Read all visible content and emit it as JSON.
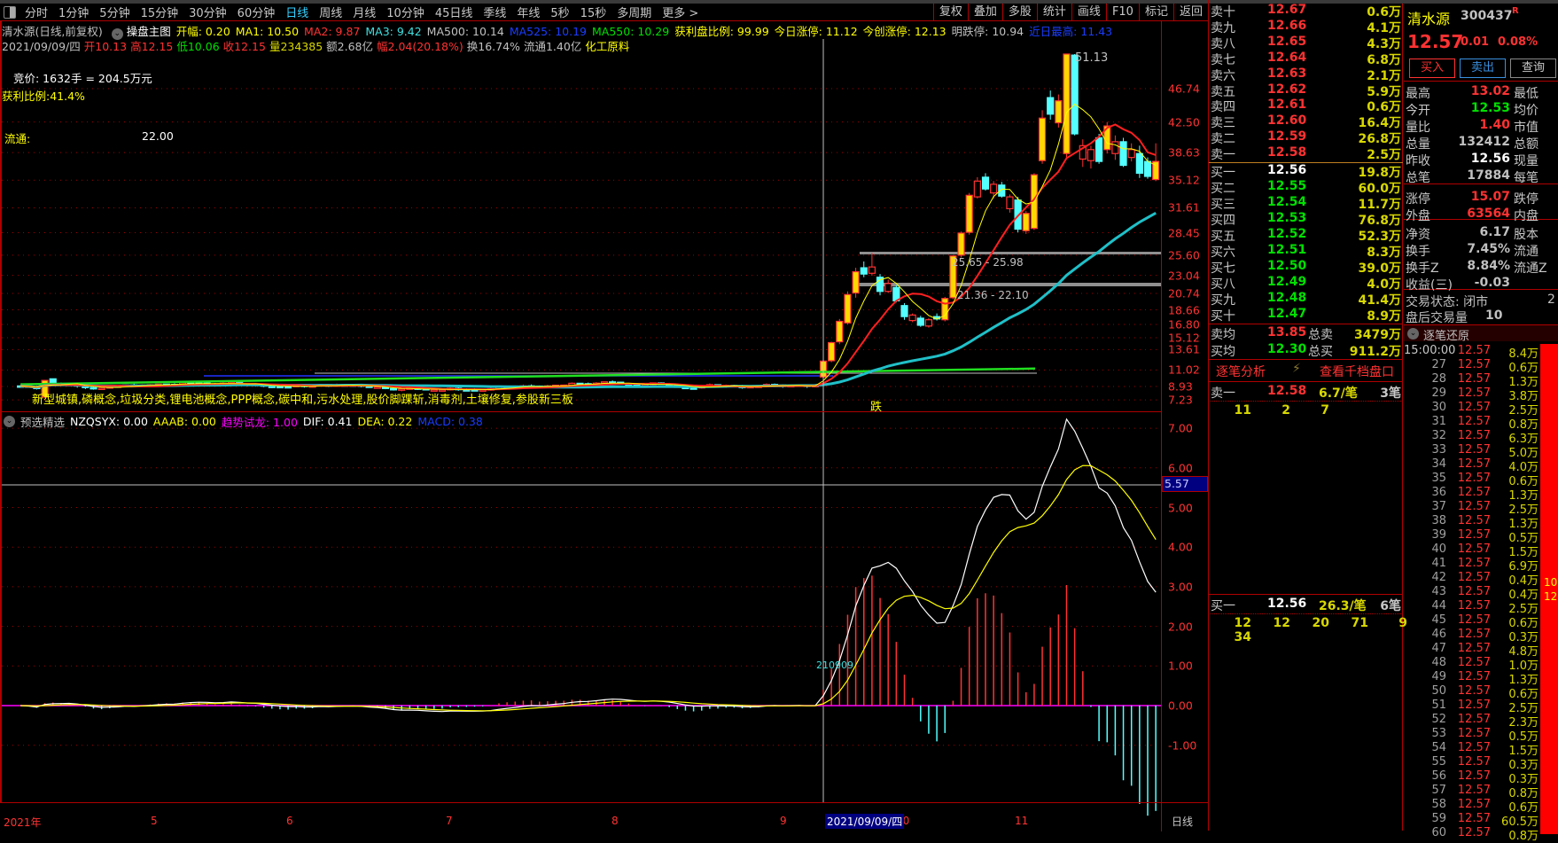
{
  "toolbar": {
    "periods": [
      "分时",
      "1分钟",
      "5分钟",
      "15分钟",
      "30分钟",
      "60分钟",
      "日线",
      "周线",
      "月线",
      "10分钟",
      "45日线",
      "季线",
      "年线",
      "5秒",
      "15秒",
      "多周期",
      "更多 >"
    ],
    "active_period": "日线",
    "right_buttons": [
      "复权",
      "叠加",
      "多股",
      "统计",
      "画线",
      "F10",
      "标记",
      "返回"
    ]
  },
  "info_line": [
    {
      "t": "清水源(日线,前复权)",
      "c": "gr"
    },
    {
      "t": "操盘主图",
      "c": "w"
    },
    {
      "t": "开幅: 0.20",
      "c": "y"
    },
    {
      "t": "MA1: 10.50",
      "c": "y"
    },
    {
      "t": "MA2: 9.87",
      "c": "r"
    },
    {
      "t": "MA3: 9.42",
      "c": "c"
    },
    {
      "t": "MA500: 10.14",
      "c": "gr"
    },
    {
      "t": "MA525: 10.19",
      "c": "b"
    },
    {
      "t": "MA550: 10.29",
      "c": "g"
    },
    {
      "t": "获利盘比例: 99.99",
      "c": "y"
    },
    {
      "t": "今日涨停: 11.12",
      "c": "y"
    },
    {
      "t": "今创涨停: 12.13",
      "c": "y"
    },
    {
      "t": "明跌停: 10.94",
      "c": "gr"
    },
    {
      "t": "近日最高: 11.43",
      "c": "b"
    }
  ],
  "bar_info": [
    {
      "t": "2021/09/09/四",
      "c": "gr"
    },
    {
      "t": "开10.13",
      "c": "r"
    },
    {
      "t": "高12.15",
      "c": "r"
    },
    {
      "t": "低10.06",
      "c": "g"
    },
    {
      "t": "收12.15",
      "c": "r"
    },
    {
      "t": "量234385",
      "c": "dy"
    },
    {
      "t": "额2.68亿",
      "c": "gr"
    },
    {
      "t": "幅2.04(20.18%)",
      "c": "r"
    },
    {
      "t": "换16.74%",
      "c": "gr"
    },
    {
      "t": "流通1.40亿",
      "c": "gr"
    },
    {
      "t": "化工原料",
      "c": "y"
    }
  ],
  "overlay": {
    "auction": "竞价: 1632手 = 204.5万元",
    "profit_ratio": "获利比例:41.4%",
    "float_label": "流通:",
    "float_value": "22.00",
    "concepts": "新型城镇,磷概念,垃圾分类,锂电池概念,PPP概念,碳中和,污水处理,股价脚踝斩,消毒剂,土壤修复,参股新三板",
    "high_label": "51.13",
    "zone1": "25.65 - 25.98",
    "zone2": "21.36 - 22.10",
    "signal_down": "跌",
    "macd_marker": "210909"
  },
  "price_axis": [
    "46.74",
    "42.50",
    "38.63",
    "35.12",
    "31.61",
    "28.45",
    "25.60",
    "23.04",
    "20.74",
    "18.66",
    "16.80",
    "15.12",
    "13.61",
    "11.02",
    "8.93",
    "7.23"
  ],
  "macd_axis": [
    "7.00",
    "6.00",
    "5.00",
    "4.00",
    "3.00",
    "2.00",
    "1.00",
    "0.00",
    "-1.00"
  ],
  "macd_cursor": "5.57",
  "macd_header": [
    {
      "t": "预选精选",
      "c": "gr"
    },
    {
      "t": "NZQSYX: 0.00",
      "c": "w"
    },
    {
      "t": "AAAB: 0.00",
      "c": "y"
    },
    {
      "t": "趋势试龙: 1.00",
      "c": "m"
    },
    {
      "t": "DIF: 0.41",
      "c": "w"
    },
    {
      "t": "DEA: 0.22",
      "c": "y"
    },
    {
      "t": "MACD: 0.38",
      "c": "b"
    }
  ],
  "time_axis": {
    "labels": [
      "2021年",
      "5",
      "6",
      "7",
      "8",
      "9",
      "10",
      "11"
    ],
    "cursor_date": "2021/09/09/四",
    "period": "日线"
  },
  "kline": {
    "recent": [
      [
        10.13,
        12.15,
        10.06,
        12.15
      ],
      [
        12.2,
        14.6,
        12.0,
        14.5
      ],
      [
        14.6,
        17.5,
        14.3,
        17.2
      ],
      [
        17.0,
        21.0,
        16.8,
        20.6
      ],
      [
        20.8,
        24.0,
        20.2,
        23.5
      ],
      [
        24.0,
        24.8,
        22.8,
        23.2
      ],
      [
        23.3,
        25.9,
        23.0,
        24.1
      ],
      [
        22.8,
        23.2,
        20.5,
        21.0
      ],
      [
        21.0,
        22.5,
        20.8,
        22.0
      ],
      [
        21.5,
        21.8,
        19.6,
        19.8
      ],
      [
        19.2,
        19.5,
        17.4,
        17.8
      ],
      [
        17.3,
        18.2,
        17.1,
        18.0
      ],
      [
        17.6,
        17.9,
        16.5,
        16.7
      ],
      [
        16.6,
        17.6,
        16.4,
        17.4
      ],
      [
        17.8,
        18.2,
        17.3,
        17.5
      ],
      [
        17.4,
        20.3,
        17.2,
        20.1
      ],
      [
        20.2,
        25.6,
        20.0,
        25.5
      ],
      [
        25.6,
        28.6,
        25.3,
        28.4
      ],
      [
        28.5,
        33.5,
        28.2,
        33.2
      ],
      [
        33.0,
        35.5,
        32.8,
        35.0
      ],
      [
        35.5,
        36.0,
        33.8,
        34.0
      ],
      [
        33.5,
        35.0,
        32.8,
        34.6
      ],
      [
        34.5,
        34.9,
        32.9,
        33.1
      ],
      [
        31.5,
        33.3,
        31.0,
        33.0
      ],
      [
        32.6,
        33.0,
        28.5,
        28.9
      ],
      [
        28.7,
        31.2,
        28.3,
        30.9
      ],
      [
        29.0,
        36.0,
        28.8,
        35.8
      ],
      [
        37.6,
        44.0,
        37.2,
        43.0
      ],
      [
        45.6,
        46.5,
        42.8,
        43.5
      ],
      [
        42.4,
        46.0,
        41.8,
        45.2
      ],
      [
        38.5,
        51.13,
        38.0,
        51.13
      ],
      [
        51.0,
        51.13,
        40.8,
        41.0
      ],
      [
        37.8,
        40.3,
        36.8,
        39.5
      ],
      [
        37.6,
        39.5,
        36.6,
        39.0
      ],
      [
        40.5,
        41.0,
        37.2,
        37.5
      ],
      [
        39.0,
        42.5,
        38.5,
        42.0
      ],
      [
        38.5,
        40.8,
        37.7,
        40.0
      ],
      [
        40.0,
        40.5,
        36.8,
        37.0
      ],
      [
        38.0,
        39.8,
        37.5,
        39.0
      ],
      [
        38.5,
        39.5,
        35.4,
        36.0
      ],
      [
        37.5,
        38.0,
        35.3,
        35.6
      ],
      [
        35.2,
        39.8,
        35.0,
        37.5
      ]
    ],
    "long_ma_range": [
      9.2,
      11.2
    ]
  },
  "order_book": {
    "asks": [
      {
        "label": "卖十",
        "price": "12.67",
        "vol": "0.6万"
      },
      {
        "label": "卖九",
        "price": "12.66",
        "vol": "4.1万"
      },
      {
        "label": "卖八",
        "price": "12.65",
        "vol": "4.3万"
      },
      {
        "label": "卖七",
        "price": "12.64",
        "vol": "6.8万"
      },
      {
        "label": "卖六",
        "price": "12.63",
        "vol": "2.1万"
      },
      {
        "label": "卖五",
        "price": "12.62",
        "vol": "5.9万"
      },
      {
        "label": "卖四",
        "price": "12.61",
        "vol": "0.6万"
      },
      {
        "label": "卖三",
        "price": "12.60",
        "vol": "16.4万"
      },
      {
        "label": "卖二",
        "price": "12.59",
        "vol": "26.8万"
      },
      {
        "label": "卖一",
        "price": "12.58",
        "vol": "2.5万"
      }
    ],
    "bids": [
      {
        "label": "买一",
        "price": "12.56",
        "vol": "19.8万"
      },
      {
        "label": "买二",
        "price": "12.55",
        "vol": "60.0万"
      },
      {
        "label": "买三",
        "price": "12.54",
        "vol": "11.7万"
      },
      {
        "label": "买四",
        "price": "12.53",
        "vol": "76.8万"
      },
      {
        "label": "买五",
        "price": "12.52",
        "vol": "52.3万"
      },
      {
        "label": "买六",
        "price": "12.51",
        "vol": "8.3万"
      },
      {
        "label": "买七",
        "price": "12.50",
        "vol": "39.0万"
      },
      {
        "label": "买八",
        "price": "12.49",
        "vol": "4.0万"
      },
      {
        "label": "买九",
        "price": "12.48",
        "vol": "41.4万"
      },
      {
        "label": "买十",
        "price": "12.47",
        "vol": "8.9万"
      }
    ],
    "ask_avg": {
      "label": "卖均",
      "price": "13.85",
      "total_label": "总卖",
      "total": "3479万"
    },
    "bid_avg": {
      "label": "买均",
      "price": "12.30",
      "total_label": "总买",
      "total": "911.2万"
    },
    "tick_analysis": "逐笔分析",
    "view_depth": "查看千档盘口",
    "ask1_queue": {
      "label": "卖一",
      "price": "12.58",
      "avg": "6.7/笔",
      "count": "3笔",
      "orders": [
        "11",
        "2",
        "7"
      ]
    },
    "bid1_queue": {
      "label": "买一",
      "price": "12.56",
      "avg": "26.3/笔",
      "count": "6笔",
      "orders": [
        "12",
        "12",
        "20",
        "71",
        "9",
        "34"
      ]
    }
  },
  "quote": {
    "name": "清水源",
    "code": "300437",
    "flag": "R",
    "price": "12.57",
    "change": "0.01",
    "change_pct": "0.08%",
    "buy": "买入",
    "sell": "卖出",
    "query": "查询",
    "stats": [
      {
        "l1": "最高",
        "v": "13.02",
        "c": "r",
        "l2": "最低"
      },
      {
        "l1": "今开",
        "v": "12.53",
        "c": "g",
        "l2": "均价"
      },
      {
        "l1": "量比",
        "v": "1.40",
        "c": "r",
        "l2": "市值"
      },
      {
        "l1": "总量",
        "v": "132412",
        "c": "gr",
        "l2": "总额"
      },
      {
        "l1": "昨收",
        "v": "12.56",
        "c": "w",
        "l2": "现量"
      },
      {
        "l1": "总笔",
        "v": "17884",
        "c": "gr",
        "l2": "每笔"
      },
      {
        "l1": "涨停",
        "v": "15.07",
        "c": "r",
        "l2": "跌停"
      },
      {
        "l1": "外盘",
        "v": "63564",
        "c": "r",
        "l2": "内盘"
      },
      {
        "l1": "净资",
        "v": "6.17",
        "c": "gr",
        "l2": "股本"
      },
      {
        "l1": "换手",
        "v": "7.45%",
        "c": "gr",
        "l2": "流通"
      },
      {
        "l1": "换手Z",
        "v": "8.84%",
        "c": "gr",
        "l2": "流通Z"
      },
      {
        "l1": "收益(三)",
        "v": "-0.03",
        "c": "gr",
        "l2": ""
      }
    ],
    "trade_state": "交易状态: 闭市",
    "trade_state_extra": "2",
    "after_hours": "盘后交易量",
    "after_hours_value": "10"
  },
  "ticks": {
    "title": "逐笔还原",
    "rows": [
      [
        "15:00:00",
        "12.57",
        "8.4万"
      ],
      [
        "27",
        "12.57",
        "0.6万"
      ],
      [
        "28",
        "12.57",
        "1.3万"
      ],
      [
        "29",
        "12.57",
        "3.8万"
      ],
      [
        "30",
        "12.57",
        "2.5万"
      ],
      [
        "31",
        "12.57",
        "0.8万"
      ],
      [
        "32",
        "12.57",
        "6.3万"
      ],
      [
        "33",
        "12.57",
        "5.0万"
      ],
      [
        "34",
        "12.57",
        "4.0万"
      ],
      [
        "35",
        "12.57",
        "0.6万"
      ],
      [
        "36",
        "12.57",
        "1.3万"
      ],
      [
        "37",
        "12.57",
        "2.5万"
      ],
      [
        "38",
        "12.57",
        "1.3万"
      ],
      [
        "39",
        "12.57",
        "0.5万"
      ],
      [
        "40",
        "12.57",
        "1.5万"
      ],
      [
        "41",
        "12.57",
        "6.9万"
      ],
      [
        "42",
        "12.57",
        "0.4万"
      ],
      [
        "43",
        "12.57",
        "0.4万"
      ],
      [
        "44",
        "12.57",
        "2.5万"
      ],
      [
        "45",
        "12.57",
        "0.6万"
      ],
      [
        "46",
        "12.57",
        "0.3万"
      ],
      [
        "47",
        "12.57",
        "4.8万"
      ],
      [
        "48",
        "12.57",
        "1.0万"
      ],
      [
        "49",
        "12.57",
        "1.3万"
      ],
      [
        "50",
        "12.57",
        "0.6万"
      ],
      [
        "51",
        "12.57",
        "2.5万"
      ],
      [
        "52",
        "12.57",
        "2.3万"
      ],
      [
        "53",
        "12.57",
        "0.5万"
      ],
      [
        "54",
        "12.57",
        "1.5万"
      ],
      [
        "55",
        "12.57",
        "0.3万"
      ],
      [
        "56",
        "12.57",
        "0.3万"
      ],
      [
        "57",
        "12.57",
        "0.8万"
      ],
      [
        "58",
        "12.57",
        "0.6万"
      ],
      [
        "59",
        "12.57",
        "60.5万"
      ],
      [
        "60",
        "12.57",
        "0.8万"
      ]
    ],
    "side_bar_labels": [
      "10",
      "12"
    ]
  },
  "colors": {
    "up": "#ff3232",
    "down": "#54ffff",
    "ma5": "#ffff00",
    "ma10": "#ff2020",
    "ma40": "#20c0c8",
    "long": "#20e020",
    "border": "#b00000"
  }
}
